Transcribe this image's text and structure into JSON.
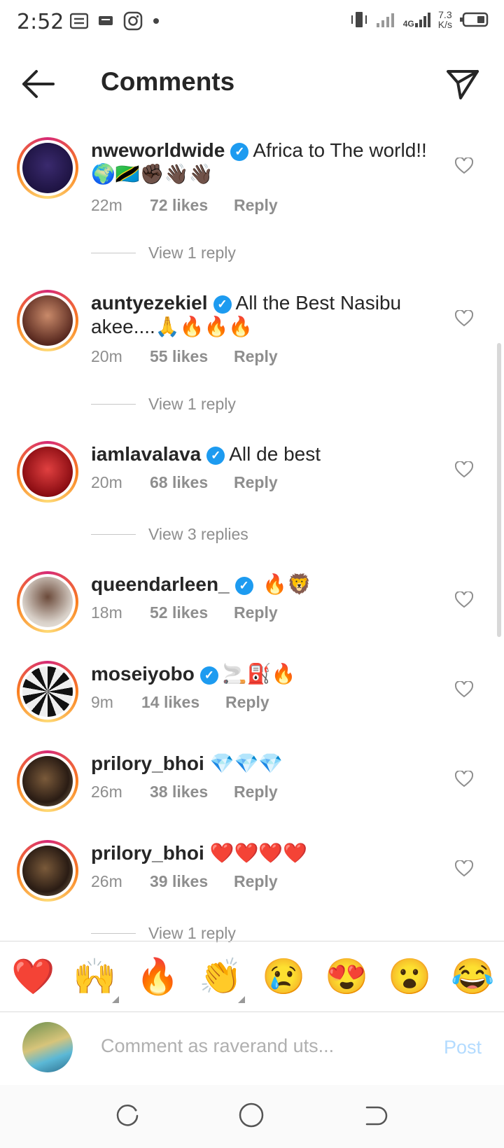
{
  "status_bar": {
    "time": "2:52",
    "net_speed_value": "7.3",
    "net_speed_unit": "K/s",
    "network": "4G"
  },
  "header": {
    "title": "Comments"
  },
  "comments": [
    {
      "username": "nweworldwide",
      "text": "Africa to The world!! 🌍🇹🇿✊🏿👋🏿👋🏿",
      "time": "22m",
      "likes": "72 likes",
      "reply": "Reply",
      "view_replies": "View 1 reply"
    },
    {
      "username": "auntyezekiel",
      "text": "All the Best Nasibu akee....🙏🔥🔥🔥",
      "time": "20m",
      "likes": "55 likes",
      "reply": "Reply",
      "view_replies": "View 1 reply"
    },
    {
      "username": "iamlavalava",
      "text": "All de best",
      "time": "20m",
      "likes": "68 likes",
      "reply": "Reply",
      "view_replies": "View 3 replies"
    },
    {
      "username": "queendarleen_",
      "text": "🔥🦁",
      "time": "18m",
      "likes": "52 likes",
      "reply": "Reply"
    },
    {
      "username": "moseiyobo",
      "text": "🚬⛽🔥",
      "time": "9m",
      "likes": "14 likes",
      "reply": "Reply"
    },
    {
      "username": "prilory_bhoi",
      "text": "💎💎💎",
      "time": "26m",
      "likes": "38 likes",
      "reply": "Reply"
    },
    {
      "username": "prilory_bhoi",
      "text": "❤️❤️❤️❤️",
      "time": "26m",
      "likes": "39 likes",
      "reply": "Reply",
      "view_replies": "View 1 reply"
    }
  ],
  "quick_emojis": [
    "❤️",
    "🙌",
    "🔥",
    "👏",
    "😢",
    "😍",
    "😮",
    "😂"
  ],
  "composer": {
    "placeholder": "Comment as raverand uts...",
    "post_label": "Post"
  },
  "colors": {
    "verified": "#1d9bf0",
    "post_inactive": "#b3dbff",
    "meta_gray": "#8e8e8e"
  }
}
